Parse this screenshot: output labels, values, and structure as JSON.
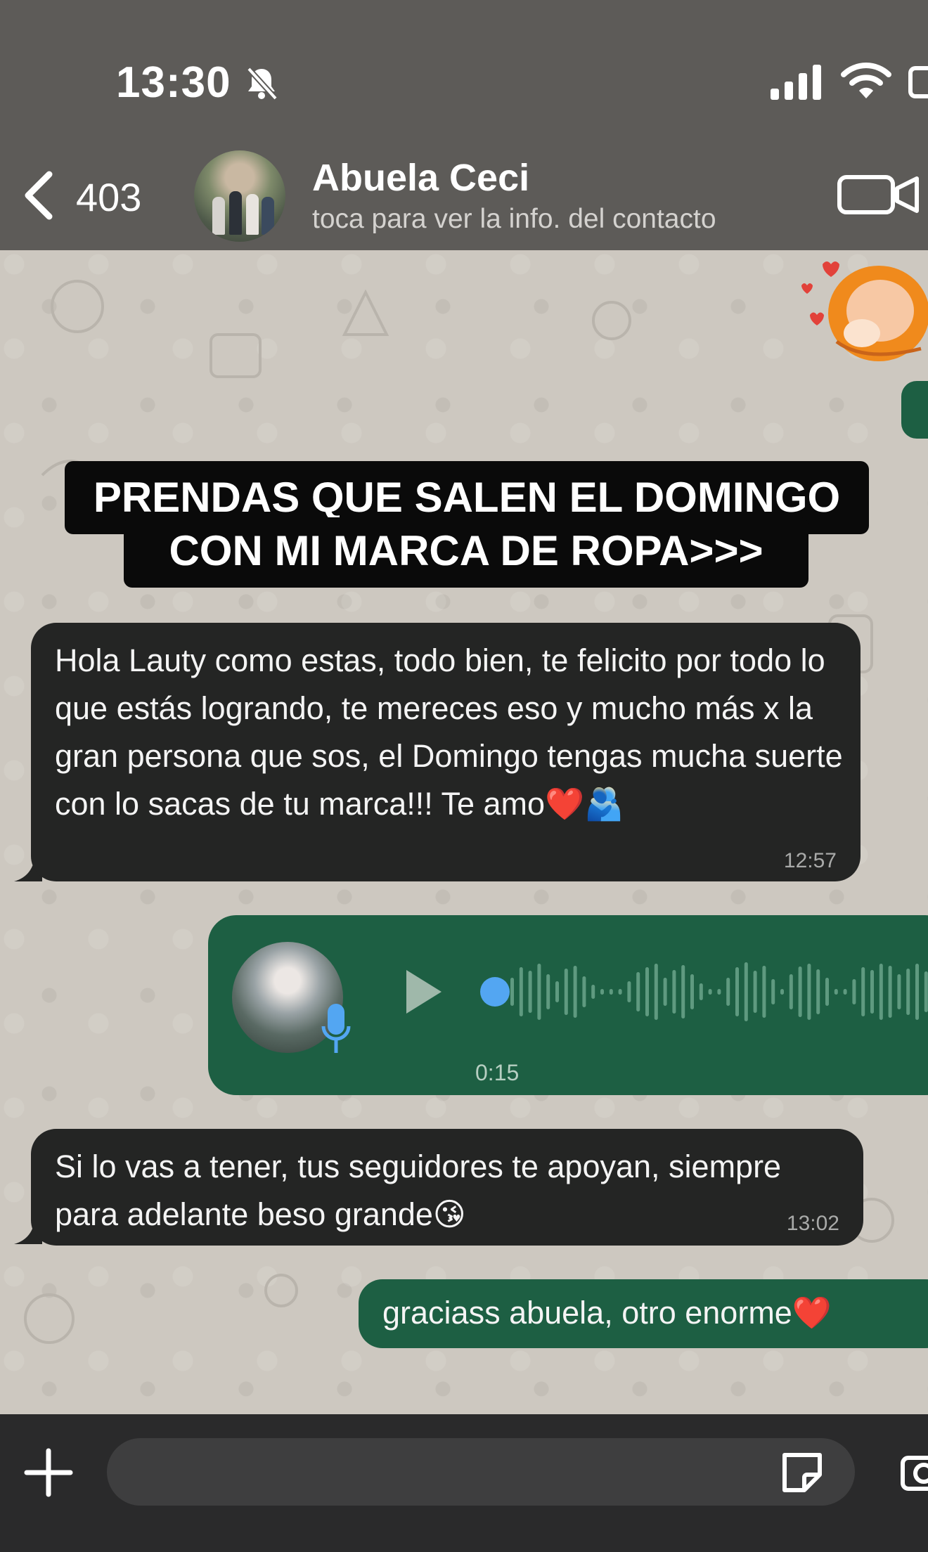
{
  "status_bar": {
    "time": "13:30",
    "icons": [
      "bell-slash-icon",
      "cellular-signal-icon",
      "wifi-icon",
      "battery-icon"
    ]
  },
  "header": {
    "back_count": "403",
    "contact_name": "Abuela Ceci",
    "contact_subtitle": "toca para ver la info. del contacto",
    "icons": [
      "chevron-left-icon",
      "video-camera-icon"
    ]
  },
  "caption": {
    "line1": "PRENDAS QUE SALEN EL DOMINGO",
    "line2": "CON MI MARCA DE ROPA>>>"
  },
  "messages": [
    {
      "direction": "incoming",
      "text": "Hola Lauty como estas, todo bien, te felicito por todo lo que estás logrando, te mereces eso y mucho más x la gran persona que sos, el Domingo tengas mucha suerte con lo sacas de tu marca!!! Te amo❤️🫂",
      "time": "12:57"
    },
    {
      "direction": "outgoing",
      "type": "voice",
      "duration": "0:15",
      "progress": 0.0
    },
    {
      "direction": "incoming",
      "text": "Si lo vas a tener, tus seguidores te apoyan, siempre para adelante beso grande😘",
      "time": "13:02"
    },
    {
      "direction": "outgoing",
      "text": "graciass abuela, otro enorme❤️"
    }
  ],
  "composer": {
    "value": "",
    "icons": [
      "plus-icon",
      "sticker-icon",
      "camera-icon"
    ]
  },
  "colors": {
    "incoming_bubble": "#242524",
    "outgoing_bubble": "#1d5f43",
    "header_bg": "#5d5b58",
    "voice_dot": "#53a6f2"
  }
}
